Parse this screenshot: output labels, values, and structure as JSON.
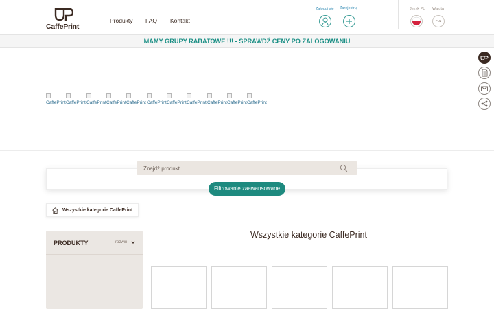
{
  "brand": {
    "name": "CaffePrint"
  },
  "nav": {
    "items": [
      "Produkty",
      "FAQ",
      "Kontakt"
    ]
  },
  "account": {
    "login_label": "Zaloguj się",
    "register_label": "Zarejestruj"
  },
  "prefs": {
    "language_label": "Język PL",
    "currency_label": "Waluta",
    "currency_value": "PLN"
  },
  "promo": {
    "text": "MAMY GRUPY RABATOWE !!! - SPRAWDŹ CENY PO ZALOGOWANIU"
  },
  "images": {
    "alt": "CaffePrint",
    "count": 11
  },
  "search": {
    "placeholder": "Znajdź produkt",
    "filter_label": "Filtrowanie zaawansowane"
  },
  "breadcrumb": {
    "label": "Wszystkie kategorie CaffePrint"
  },
  "sidebar": {
    "title": "PRODUKTY",
    "expand_label": "rozwiń"
  },
  "main": {
    "title": "Wszystkie kategorie CaffePrint"
  },
  "colors": {
    "accent": "#1e8a7f",
    "brand_dark": "#3b2a22",
    "link": "#3a8fb7"
  },
  "icons": {
    "header": [
      "login-user-icon",
      "register-plus-icon",
      "poland-flag-icon",
      "currency-icon"
    ],
    "floating": [
      "caffeprint-logo-icon",
      "document-icon",
      "mail-icon",
      "share-icon"
    ]
  }
}
